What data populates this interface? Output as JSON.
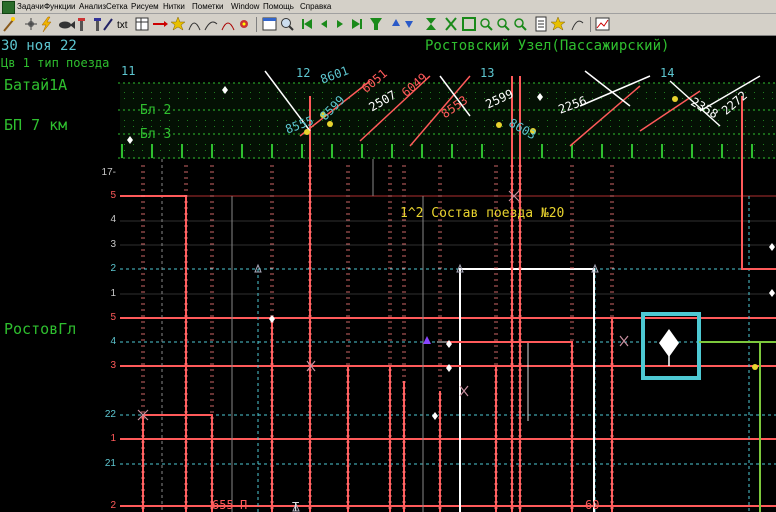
{
  "menu": [
    "Задачи",
    "Функции",
    "Анализ",
    "Сетка",
    "Рисуем",
    "Нитки",
    "Пометки",
    "Window",
    "Помощь",
    "Справка"
  ],
  "toolbar": {
    "text_button": "txt",
    "icons": [
      "wand-icon",
      "sparkle-icon",
      "lightning-icon",
      "fish-icon",
      "tool-icon",
      "tool2-icon",
      "text-icon",
      "table-icon",
      "arrow-right-icon",
      "star-icon",
      "curve-icon",
      "curve2-icon",
      "curve3-icon",
      "flower-icon",
      "window-icon",
      "zoom-icon",
      "go-first-icon",
      "go-prev-icon",
      "go-next-icon",
      "go-last-icon",
      "filter-icon",
      "arrow-up-icon",
      "arrow-down-icon",
      "hourglass-icon",
      "expand-icon",
      "collapse-icon",
      "search-icon",
      "search2-icon",
      "search3-icon",
      "search4-icon",
      "document-icon",
      "star2-icon",
      "curve4-icon",
      "chart-icon"
    ]
  },
  "header": {
    "date": "30 ноя 22",
    "node": "Ростовский Узел(Пассажирский)",
    "subtitle": "Цв 1 тип поезда"
  },
  "stations": {
    "bataysk": "Батай1А",
    "bp7": "БП 7 км",
    "bl2": "Бл 2",
    "bl3": "Бл 3",
    "rostov": "РостовГл"
  },
  "graph": {
    "hour_marks": [
      "11",
      "12",
      "13",
      "14"
    ],
    "track_labels": [
      "17-",
      "5",
      "4",
      "3",
      "2",
      "1",
      "5",
      "4",
      "3",
      "22",
      "1",
      "21",
      "2"
    ],
    "train_numbers": [
      "8601",
      "6051",
      "6049",
      "8599",
      "8555",
      "8553",
      "2507",
      "8603",
      "2256",
      "2599",
      "2358",
      "2272"
    ],
    "annotation": "1^2 Состав поезда №20",
    "bottom_labels": [
      "655",
      "П",
      "Т",
      "60"
    ]
  },
  "colors": {
    "green": "#2fbf2f",
    "red": "#ff5a5a",
    "cyan": "#4ec9d3",
    "yellow": "#e8d32e",
    "white": "#ffffff"
  }
}
